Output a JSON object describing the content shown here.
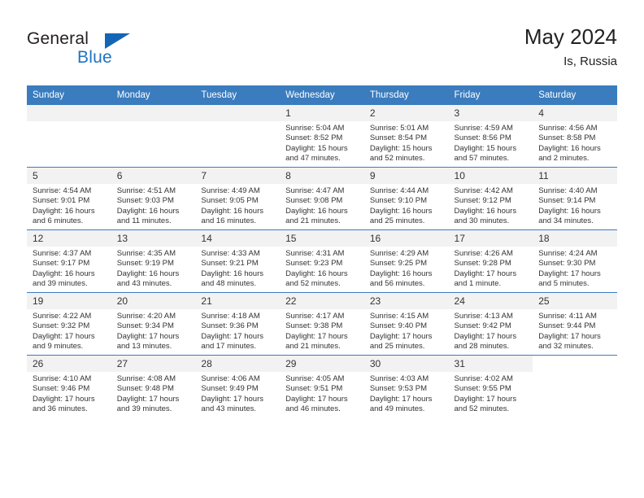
{
  "brand": {
    "name_part1": "General",
    "name_part2": "Blue",
    "colors": {
      "dark": "#231f20",
      "blue": "#1f73c4",
      "header_blue": "#3a7cbe",
      "shade": "#f2f2f2"
    }
  },
  "header": {
    "title": "May 2024",
    "subtitle": "Is, Russia"
  },
  "weekday_headers": [
    "Sunday",
    "Monday",
    "Tuesday",
    "Wednesday",
    "Thursday",
    "Friday",
    "Saturday"
  ],
  "weeks": [
    {
      "shaded": true,
      "days": [
        {
          "empty": true
        },
        {
          "empty": true
        },
        {
          "empty": true
        },
        {
          "day": "1",
          "sunrise": "Sunrise: 5:04 AM",
          "sunset": "Sunset: 8:52 PM",
          "daylight_line1": "Daylight: 15 hours",
          "daylight_line2": "and 47 minutes."
        },
        {
          "day": "2",
          "sunrise": "Sunrise: 5:01 AM",
          "sunset": "Sunset: 8:54 PM",
          "daylight_line1": "Daylight: 15 hours",
          "daylight_line2": "and 52 minutes."
        },
        {
          "day": "3",
          "sunrise": "Sunrise: 4:59 AM",
          "sunset": "Sunset: 8:56 PM",
          "daylight_line1": "Daylight: 15 hours",
          "daylight_line2": "and 57 minutes."
        },
        {
          "day": "4",
          "sunrise": "Sunrise: 4:56 AM",
          "sunset": "Sunset: 8:58 PM",
          "daylight_line1": "Daylight: 16 hours",
          "daylight_line2": "and 2 minutes."
        }
      ]
    },
    {
      "shaded": true,
      "days": [
        {
          "day": "5",
          "sunrise": "Sunrise: 4:54 AM",
          "sunset": "Sunset: 9:01 PM",
          "daylight_line1": "Daylight: 16 hours",
          "daylight_line2": "and 6 minutes."
        },
        {
          "day": "6",
          "sunrise": "Sunrise: 4:51 AM",
          "sunset": "Sunset: 9:03 PM",
          "daylight_line1": "Daylight: 16 hours",
          "daylight_line2": "and 11 minutes."
        },
        {
          "day": "7",
          "sunrise": "Sunrise: 4:49 AM",
          "sunset": "Sunset: 9:05 PM",
          "daylight_line1": "Daylight: 16 hours",
          "daylight_line2": "and 16 minutes."
        },
        {
          "day": "8",
          "sunrise": "Sunrise: 4:47 AM",
          "sunset": "Sunset: 9:08 PM",
          "daylight_line1": "Daylight: 16 hours",
          "daylight_line2": "and 21 minutes."
        },
        {
          "day": "9",
          "sunrise": "Sunrise: 4:44 AM",
          "sunset": "Sunset: 9:10 PM",
          "daylight_line1": "Daylight: 16 hours",
          "daylight_line2": "and 25 minutes."
        },
        {
          "day": "10",
          "sunrise": "Sunrise: 4:42 AM",
          "sunset": "Sunset: 9:12 PM",
          "daylight_line1": "Daylight: 16 hours",
          "daylight_line2": "and 30 minutes."
        },
        {
          "day": "11",
          "sunrise": "Sunrise: 4:40 AM",
          "sunset": "Sunset: 9:14 PM",
          "daylight_line1": "Daylight: 16 hours",
          "daylight_line2": "and 34 minutes."
        }
      ]
    },
    {
      "shaded": true,
      "days": [
        {
          "day": "12",
          "sunrise": "Sunrise: 4:37 AM",
          "sunset": "Sunset: 9:17 PM",
          "daylight_line1": "Daylight: 16 hours",
          "daylight_line2": "and 39 minutes."
        },
        {
          "day": "13",
          "sunrise": "Sunrise: 4:35 AM",
          "sunset": "Sunset: 9:19 PM",
          "daylight_line1": "Daylight: 16 hours",
          "daylight_line2": "and 43 minutes."
        },
        {
          "day": "14",
          "sunrise": "Sunrise: 4:33 AM",
          "sunset": "Sunset: 9:21 PM",
          "daylight_line1": "Daylight: 16 hours",
          "daylight_line2": "and 48 minutes."
        },
        {
          "day": "15",
          "sunrise": "Sunrise: 4:31 AM",
          "sunset": "Sunset: 9:23 PM",
          "daylight_line1": "Daylight: 16 hours",
          "daylight_line2": "and 52 minutes."
        },
        {
          "day": "16",
          "sunrise": "Sunrise: 4:29 AM",
          "sunset": "Sunset: 9:25 PM",
          "daylight_line1": "Daylight: 16 hours",
          "daylight_line2": "and 56 minutes."
        },
        {
          "day": "17",
          "sunrise": "Sunrise: 4:26 AM",
          "sunset": "Sunset: 9:28 PM",
          "daylight_line1": "Daylight: 17 hours",
          "daylight_line2": "and 1 minute."
        },
        {
          "day": "18",
          "sunrise": "Sunrise: 4:24 AM",
          "sunset": "Sunset: 9:30 PM",
          "daylight_line1": "Daylight: 17 hours",
          "daylight_line2": "and 5 minutes."
        }
      ]
    },
    {
      "shaded": true,
      "days": [
        {
          "day": "19",
          "sunrise": "Sunrise: 4:22 AM",
          "sunset": "Sunset: 9:32 PM",
          "daylight_line1": "Daylight: 17 hours",
          "daylight_line2": "and 9 minutes."
        },
        {
          "day": "20",
          "sunrise": "Sunrise: 4:20 AM",
          "sunset": "Sunset: 9:34 PM",
          "daylight_line1": "Daylight: 17 hours",
          "daylight_line2": "and 13 minutes."
        },
        {
          "day": "21",
          "sunrise": "Sunrise: 4:18 AM",
          "sunset": "Sunset: 9:36 PM",
          "daylight_line1": "Daylight: 17 hours",
          "daylight_line2": "and 17 minutes."
        },
        {
          "day": "22",
          "sunrise": "Sunrise: 4:17 AM",
          "sunset": "Sunset: 9:38 PM",
          "daylight_line1": "Daylight: 17 hours",
          "daylight_line2": "and 21 minutes."
        },
        {
          "day": "23",
          "sunrise": "Sunrise: 4:15 AM",
          "sunset": "Sunset: 9:40 PM",
          "daylight_line1": "Daylight: 17 hours",
          "daylight_line2": "and 25 minutes."
        },
        {
          "day": "24",
          "sunrise": "Sunrise: 4:13 AM",
          "sunset": "Sunset: 9:42 PM",
          "daylight_line1": "Daylight: 17 hours",
          "daylight_line2": "and 28 minutes."
        },
        {
          "day": "25",
          "sunrise": "Sunrise: 4:11 AM",
          "sunset": "Sunset: 9:44 PM",
          "daylight_line1": "Daylight: 17 hours",
          "daylight_line2": "and 32 minutes."
        }
      ]
    },
    {
      "shaded": true,
      "days": [
        {
          "day": "26",
          "sunrise": "Sunrise: 4:10 AM",
          "sunset": "Sunset: 9:46 PM",
          "daylight_line1": "Daylight: 17 hours",
          "daylight_line2": "and 36 minutes."
        },
        {
          "day": "27",
          "sunrise": "Sunrise: 4:08 AM",
          "sunset": "Sunset: 9:48 PM",
          "daylight_line1": "Daylight: 17 hours",
          "daylight_line2": "and 39 minutes."
        },
        {
          "day": "28",
          "sunrise": "Sunrise: 4:06 AM",
          "sunset": "Sunset: 9:49 PM",
          "daylight_line1": "Daylight: 17 hours",
          "daylight_line2": "and 43 minutes."
        },
        {
          "day": "29",
          "sunrise": "Sunrise: 4:05 AM",
          "sunset": "Sunset: 9:51 PM",
          "daylight_line1": "Daylight: 17 hours",
          "daylight_line2": "and 46 minutes."
        },
        {
          "day": "30",
          "sunrise": "Sunrise: 4:03 AM",
          "sunset": "Sunset: 9:53 PM",
          "daylight_line1": "Daylight: 17 hours",
          "daylight_line2": "and 49 minutes."
        },
        {
          "day": "31",
          "sunrise": "Sunrise: 4:02 AM",
          "sunset": "Sunset: 9:55 PM",
          "daylight_line1": "Daylight: 17 hours",
          "daylight_line2": "and 52 minutes."
        },
        {
          "blank": true
        }
      ]
    }
  ]
}
